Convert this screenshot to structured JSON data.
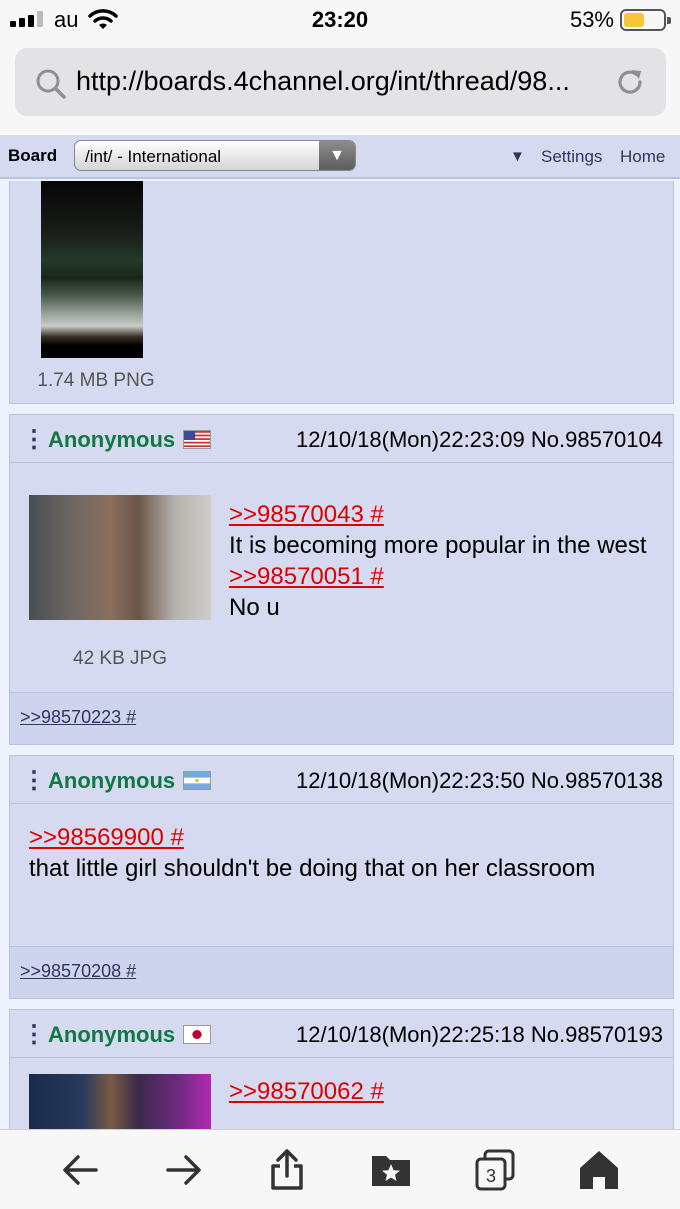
{
  "status_bar": {
    "carrier": "au",
    "time": "23:20",
    "battery_percent": "53%",
    "battery_level": 0.53,
    "signal_icon": "signal-icon",
    "wifi_icon": "wifi-icon"
  },
  "browser": {
    "url": "http://boards.4channel.org/int/thread/98...",
    "search_icon": "search-icon",
    "reload_icon": "reload-icon"
  },
  "board_bar": {
    "label": "Board",
    "selected": "/int/ - International",
    "dropdown_arrow": "▼",
    "settings_marker": "▼",
    "settings": "Settings",
    "home": "Home"
  },
  "posts": [
    {
      "file_info": "1.74 MB PNG"
    },
    {
      "name": "Anonymous",
      "flag": "flag-us",
      "date": "12/10/18(Mon)22:23:09",
      "no": "No.98570104",
      "file_info": "42 KB JPG",
      "quote1": ">>98570043 #",
      "line1": "It is becoming more popular in the west",
      "quote2": ">>98570051 #",
      "line2": "No u",
      "backlink": ">>98570223 #"
    },
    {
      "name": "Anonymous",
      "flag": "flag-ar",
      "date": "12/10/18(Mon)22:23:50",
      "no": "No.98570138",
      "quote1": ">>98569900 #",
      "line1": "that little girl shouldn't be doing that on her classroom",
      "backlink": ">>98570208 #"
    },
    {
      "name": "Anonymous",
      "flag": "flag-jp",
      "date": "12/10/18(Mon)22:25:18",
      "no": "No.98570193",
      "quote1": ">>98570062 #"
    }
  ],
  "toolbar": {
    "back_icon": "back-icon",
    "forward_icon": "forward-icon",
    "share_icon": "share-icon",
    "bookmarks_icon": "bookmarks-icon",
    "tabs_count": "3",
    "home_icon": "home-icon"
  },
  "colors": {
    "post_bg": "#d6daf0",
    "page_bg": "#eef2ff",
    "name": "#117743",
    "quote": "#dd0000",
    "link": "#34345c"
  }
}
